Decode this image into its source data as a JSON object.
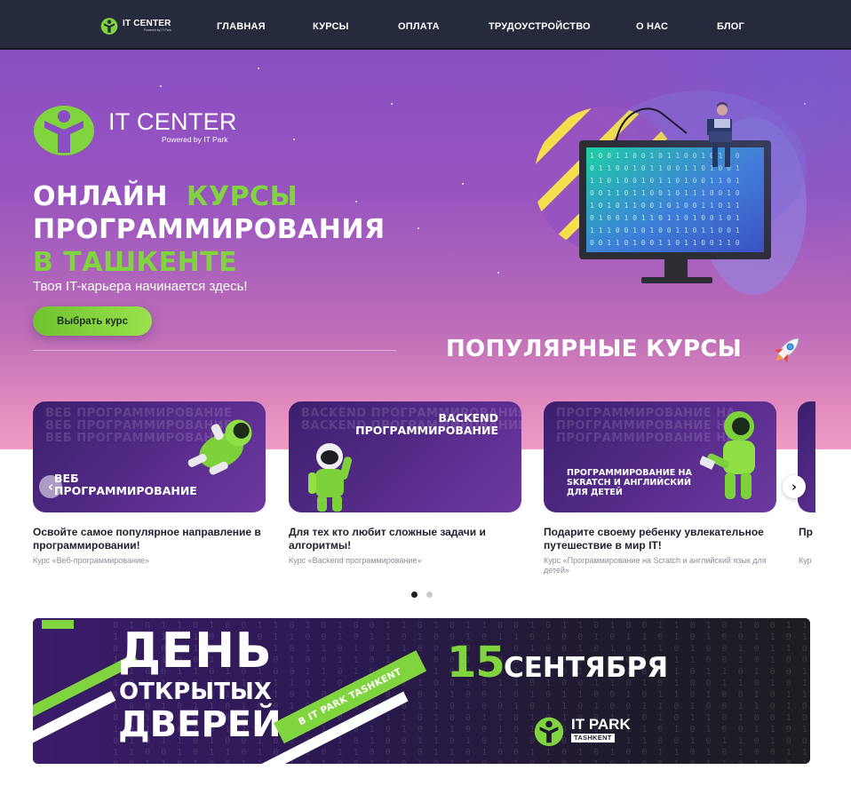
{
  "nav": {
    "logo": {
      "name": "IT CENTER",
      "tagline": "Powered by IT Park"
    },
    "links": [
      "ГЛАВНАЯ",
      "КУРСЫ",
      "ОПЛАТА",
      "ТРУДОУСТРОЙСТВО",
      "О НАС",
      "БЛОГ"
    ]
  },
  "hero": {
    "logo": {
      "name": "IT CENTER",
      "tagline": "Powered by IT Park"
    },
    "title": {
      "line1_white": "ОНЛАЙН",
      "line1_green": "КУРСЫ",
      "line2": "ПРОГРАММИРОВАНИЯ",
      "line3": "В ТАШКЕНТЕ"
    },
    "subtitle": "Твоя IT-карьера начинается здесь!",
    "cta": "Выбрать курс"
  },
  "popular": {
    "title": "ПОПУЛЯРНЫЕ КУРСЫ"
  },
  "courses": [
    {
      "card_title_lines": [
        "ВЕБ",
        "ПРОГРАММИРОВАНИЕ"
      ],
      "bg_text": "ВЕБ ПРОГРАММИРОВАНИЕ",
      "description": "Освойте самое популярное направление в программировании!",
      "course": "Курс «Веб-программирование»"
    },
    {
      "card_title_lines": [
        "BACKEND",
        "ПРОГРАММИРОВАНИЕ"
      ],
      "bg_text": "BACKEND ПРОГРАММИРОВАНИЕ",
      "description": "Для тех кто любит сложные задачи и алгоритмы!",
      "course": "Курс «Backend программирование»"
    },
    {
      "card_title_lines": [
        "ПРОГРАММИРОВАНИЕ НА",
        "SKRATCH И АНГЛИЙСКИЙ",
        "ДЛЯ ДЕТЕЙ"
      ],
      "bg_text": "ПРОГРАММИРОВАНИЕ НА",
      "description": "Подарите своему ребенку увлекательное путешествие в мир IT!",
      "course": "Курс «Программирование на Scratch и английский язык для детей»"
    }
  ],
  "peek": {
    "description": "Пр",
    "course": "Кур"
  },
  "carousel": {
    "prev": "‹",
    "next": "›"
  },
  "banner": {
    "day": "ДЕНЬ",
    "open": "ОТКРЫТЫХ",
    "doors": "ДВЕРЕЙ",
    "date_num": "15",
    "date_month": "СЕНТЯБРЯ",
    "badge": "В IT PARK TASHKENT",
    "logo": {
      "name": "IT PARK",
      "sub": "TASHKENT"
    }
  },
  "colors": {
    "accent_green": "#80d43e",
    "nav_bg": "#252a3d",
    "hero_purple": "#8a4ec2",
    "card_purple": "#3a1f6d"
  }
}
